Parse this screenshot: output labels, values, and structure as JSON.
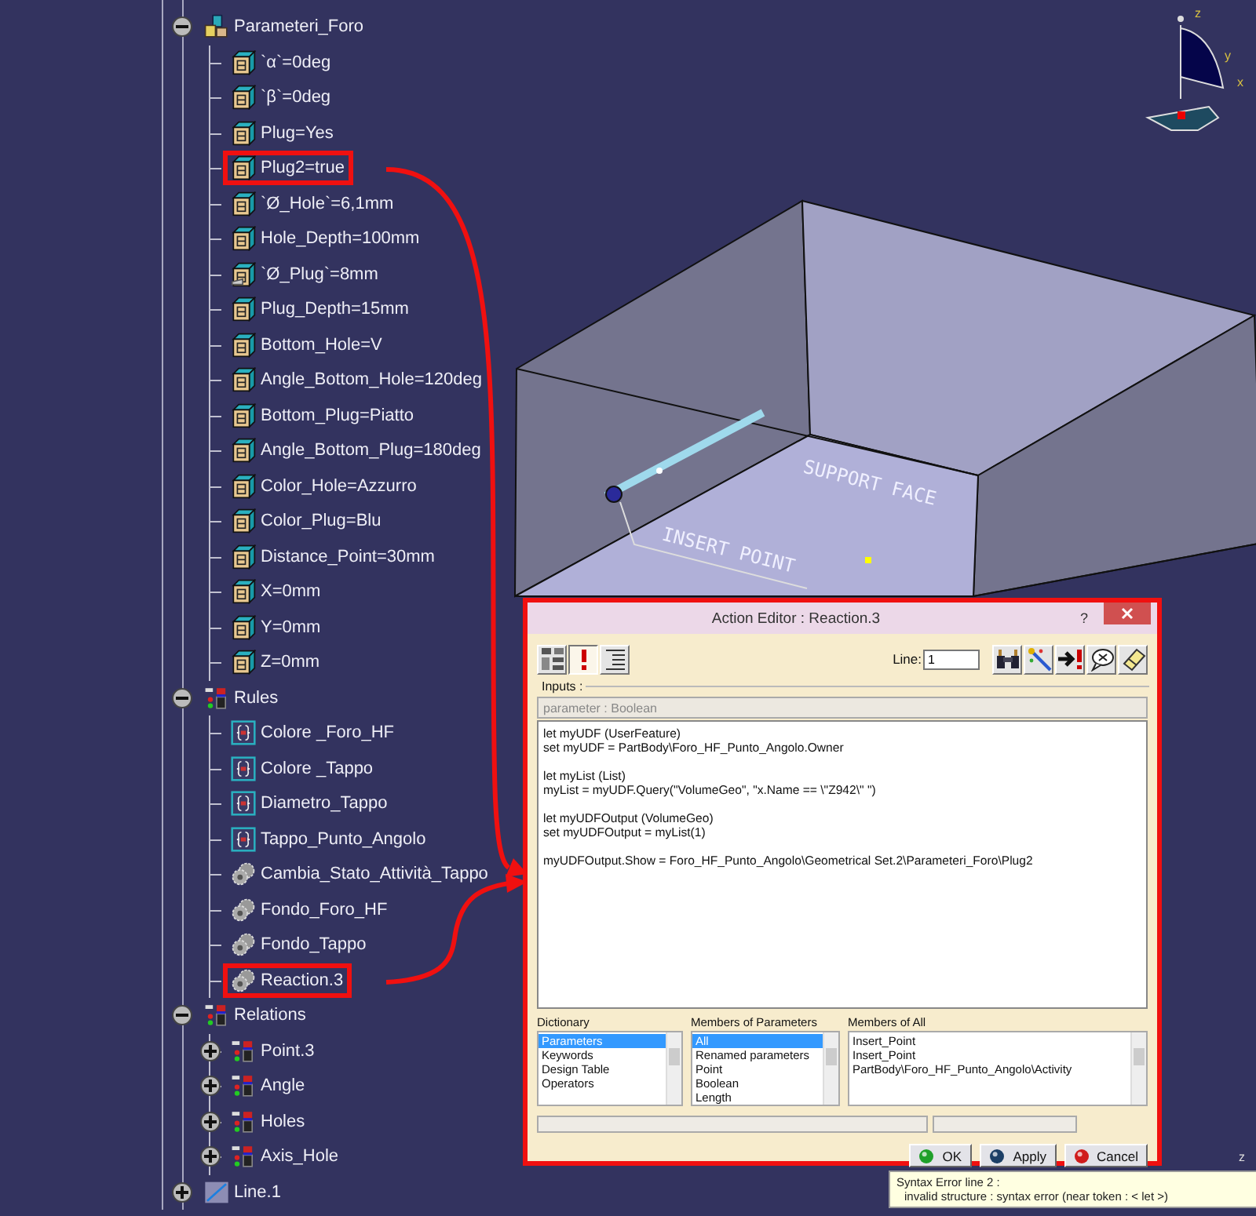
{
  "tree": [
    {
      "label": "Parameteri_Foro",
      "kind": "set",
      "expanded": true,
      "highlighted": false,
      "children": [
        {
          "label": "`α`=0deg",
          "kind": "param",
          "highlighted": false
        },
        {
          "label": "`β`=0deg",
          "kind": "param",
          "highlighted": false
        },
        {
          "label": "Plug=Yes",
          "kind": "param",
          "highlighted": false
        },
        {
          "label": "Plug2=true",
          "kind": "param",
          "highlighted": true
        },
        {
          "label": "`Ø_Hole`=6,1mm",
          "kind": "param",
          "highlighted": false
        },
        {
          "label": "Hole_Depth=100mm",
          "kind": "param",
          "highlighted": false
        },
        {
          "label": "`Ø_Plug`=8mm",
          "kind": "param-linked",
          "highlighted": false
        },
        {
          "label": "Plug_Depth=15mm",
          "kind": "param",
          "highlighted": false
        },
        {
          "label": "Bottom_Hole=V",
          "kind": "param",
          "highlighted": false
        },
        {
          "label": "Angle_Bottom_Hole=120deg",
          "kind": "param",
          "highlighted": false
        },
        {
          "label": "Bottom_Plug=Piatto",
          "kind": "param",
          "highlighted": false
        },
        {
          "label": "Angle_Bottom_Plug=180deg",
          "kind": "param",
          "highlighted": false
        },
        {
          "label": "Color_Hole=Azzurro",
          "kind": "param",
          "highlighted": false
        },
        {
          "label": "Color_Plug=Blu",
          "kind": "param",
          "highlighted": false
        },
        {
          "label": "Distance_Point=30mm",
          "kind": "param",
          "highlighted": false
        },
        {
          "label": "X=0mm",
          "kind": "param",
          "highlighted": false
        },
        {
          "label": "Y=0mm",
          "kind": "param",
          "highlighted": false
        },
        {
          "label": "Z=0mm",
          "kind": "param",
          "highlighted": false
        }
      ]
    },
    {
      "label": "Rules",
      "kind": "relations",
      "expanded": true,
      "highlighted": false,
      "children": [
        {
          "label": "Colore _Foro_HF",
          "kind": "rule",
          "highlighted": false
        },
        {
          "label": "Colore _Tappo",
          "kind": "rule",
          "highlighted": false
        },
        {
          "label": "Diametro_Tappo",
          "kind": "rule",
          "highlighted": false
        },
        {
          "label": "Tappo_Punto_Angolo",
          "kind": "rule",
          "highlighted": false
        },
        {
          "label": "Cambia_Stato_Attività_Tappo",
          "kind": "reaction",
          "highlighted": false
        },
        {
          "label": "Fondo_Foro_HF",
          "kind": "reaction",
          "highlighted": false
        },
        {
          "label": "Fondo_Tappo",
          "kind": "reaction",
          "highlighted": false
        },
        {
          "label": "Reaction.3",
          "kind": "reaction",
          "highlighted": true
        }
      ]
    },
    {
      "label": "Relations",
      "kind": "relations",
      "expanded": true,
      "highlighted": false,
      "children": [
        {
          "label": "Point.3",
          "kind": "relations",
          "expanded": false,
          "highlighted": false
        },
        {
          "label": "Angle",
          "kind": "relations",
          "expanded": false,
          "highlighted": false
        },
        {
          "label": "Holes",
          "kind": "relations",
          "expanded": false,
          "highlighted": false
        },
        {
          "label": "Axis_Hole",
          "kind": "relations",
          "expanded": false,
          "highlighted": false
        }
      ]
    },
    {
      "label": "Line.1",
      "kind": "line",
      "expanded": false,
      "highlighted": false
    }
  ],
  "viewport": {
    "labels": [
      "SUPPORT FACE",
      "INSERT POINT"
    ],
    "compass_axes": [
      "z",
      "y",
      "x"
    ],
    "corner_axis_label": "z"
  },
  "dialog": {
    "title": "Action Editor : Reaction.3",
    "help": "?",
    "toolbar_left": [
      {
        "kind": "tree",
        "selected": false
      },
      {
        "kind": "error",
        "selected": true
      },
      {
        "kind": "outline",
        "selected": false
      }
    ],
    "line_label": "Line:",
    "line_value": "1",
    "toolbar_right": [
      {
        "kind": "binoculars"
      },
      {
        "kind": "wand"
      },
      {
        "kind": "goto-error"
      },
      {
        "kind": "comment"
      },
      {
        "kind": "eraser"
      }
    ],
    "inputs_label": "Inputs :",
    "input_type": "parameter : Boolean",
    "code": "let myUDF (UserFeature)\nset myUDF = PartBody\\Foro_HF_Punto_Angolo.Owner\n\nlet myList (List)\nmyList = myUDF.Query(\"VolumeGeo\", \"x.Name == \\\"Z942\\\" \")\n\nlet myUDFOutput (VolumeGeo)\nset myUDFOutput = myList(1)\n\nmyUDFOutput.Show = Foro_HF_Punto_Angolo\\Geometrical Set.2\\Parameteri_Foro\\Plug2",
    "lists": [
      {
        "title": "Dictionary",
        "items": [
          {
            "label": "Parameters",
            "selected": true
          },
          {
            "label": "Keywords",
            "selected": false
          },
          {
            "label": "Design Table",
            "selected": false
          },
          {
            "label": "Operators",
            "selected": false
          }
        ]
      },
      {
        "title": "Members of Parameters",
        "items": [
          {
            "label": "All",
            "selected": true
          },
          {
            "label": "Renamed parameters",
            "selected": false
          },
          {
            "label": "Point",
            "selected": false
          },
          {
            "label": "Boolean",
            "selected": false
          },
          {
            "label": "Length",
            "selected": false
          }
        ]
      },
      {
        "title": "Members of All",
        "items": [
          {
            "label": "Insert_Point",
            "selected": false
          },
          {
            "label": "Insert_Point",
            "selected": false
          },
          {
            "label": "PartBody\\Foro_HF_Punto_Angolo\\Activity",
            "selected": false
          }
        ]
      }
    ],
    "buttons": [
      {
        "label": "OK",
        "kind": "ok"
      },
      {
        "label": "Apply",
        "kind": "apply"
      },
      {
        "label": "Cancel",
        "kind": "cancel"
      }
    ]
  },
  "tooltip": {
    "lines": [
      "Syntax Error line 2 :",
      "invalid structure :  syntax error (near token : < let >)"
    ]
  }
}
